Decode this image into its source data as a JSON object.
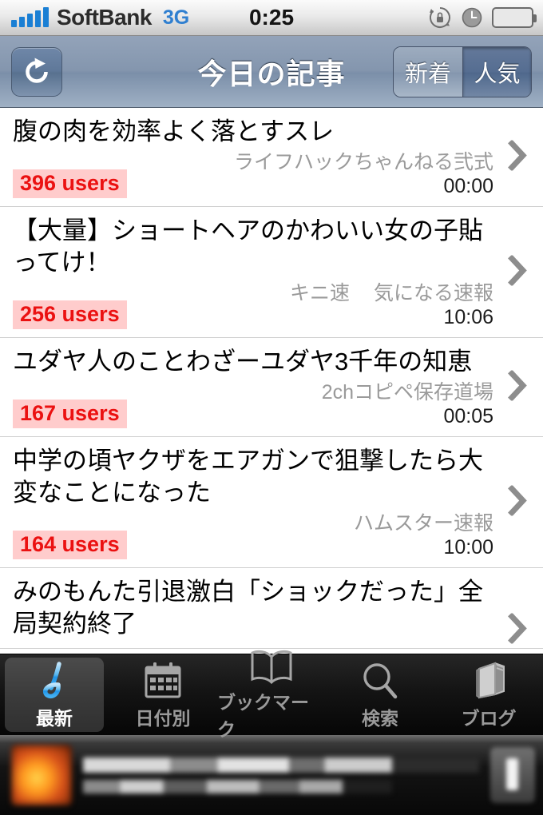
{
  "statusbar": {
    "carrier": "SoftBank",
    "network": "3G",
    "time": "0:25",
    "signal_bars": 5,
    "battery_percent": 62,
    "icons": [
      "signal-bars-icon",
      "rotation-lock-icon",
      "alarm-clock-icon",
      "battery-icon"
    ]
  },
  "navbar": {
    "title": "今日の記事",
    "refresh_icon": "refresh-icon",
    "segments": [
      {
        "label": "新着",
        "selected": false
      },
      {
        "label": "人気",
        "selected": true
      }
    ]
  },
  "articles": [
    {
      "title": "腹の肉を効率よく落とすスレ",
      "users": "396 users",
      "sources": [
        "ライフハックちゃんねる弐式"
      ],
      "time": "00:00"
    },
    {
      "title": "【大量】ショートヘアのかわいい女の子貼ってけ！",
      "users": "256 users",
      "sources": [
        "キニ速",
        "気になる速報"
      ],
      "time": "10:06"
    },
    {
      "title": "ユダヤ人のことわざーユダヤ3千年の知恵",
      "users": "167 users",
      "sources": [
        "2chコピペ保存道場"
      ],
      "time": "00:05"
    },
    {
      "title": "中学の頃ヤクザをエアガンで狙撃したら大変なことになった",
      "users": "164 users",
      "sources": [
        "ハムスター速報"
      ],
      "time": "10:00"
    },
    {
      "title": "みのもんた引退激白「ショックだった」全局契約終了",
      "users": "",
      "sources": [],
      "time": ""
    }
  ],
  "tabbar": {
    "items": [
      {
        "label": "最新",
        "icon": "ma-character-icon",
        "selected": true
      },
      {
        "label": "日付別",
        "icon": "calendar-icon",
        "selected": false
      },
      {
        "label": "ブックマーク",
        "icon": "open-book-icon",
        "selected": false
      },
      {
        "label": "検索",
        "icon": "magnifier-icon",
        "selected": false
      },
      {
        "label": "ブログ",
        "icon": "books-stack-icon",
        "selected": false
      }
    ]
  },
  "ad": {
    "icon": "app-icon",
    "line1": "",
    "line2": "",
    "button": ""
  },
  "colors": {
    "badge_text": "#eb1111",
    "badge_bg": "#ffcccc",
    "navbar": "#8496ae",
    "accent_blue": "#2f7fd0",
    "tabbar_bg": "#141414",
    "selected_tab_icon": "#3aaaf0"
  }
}
